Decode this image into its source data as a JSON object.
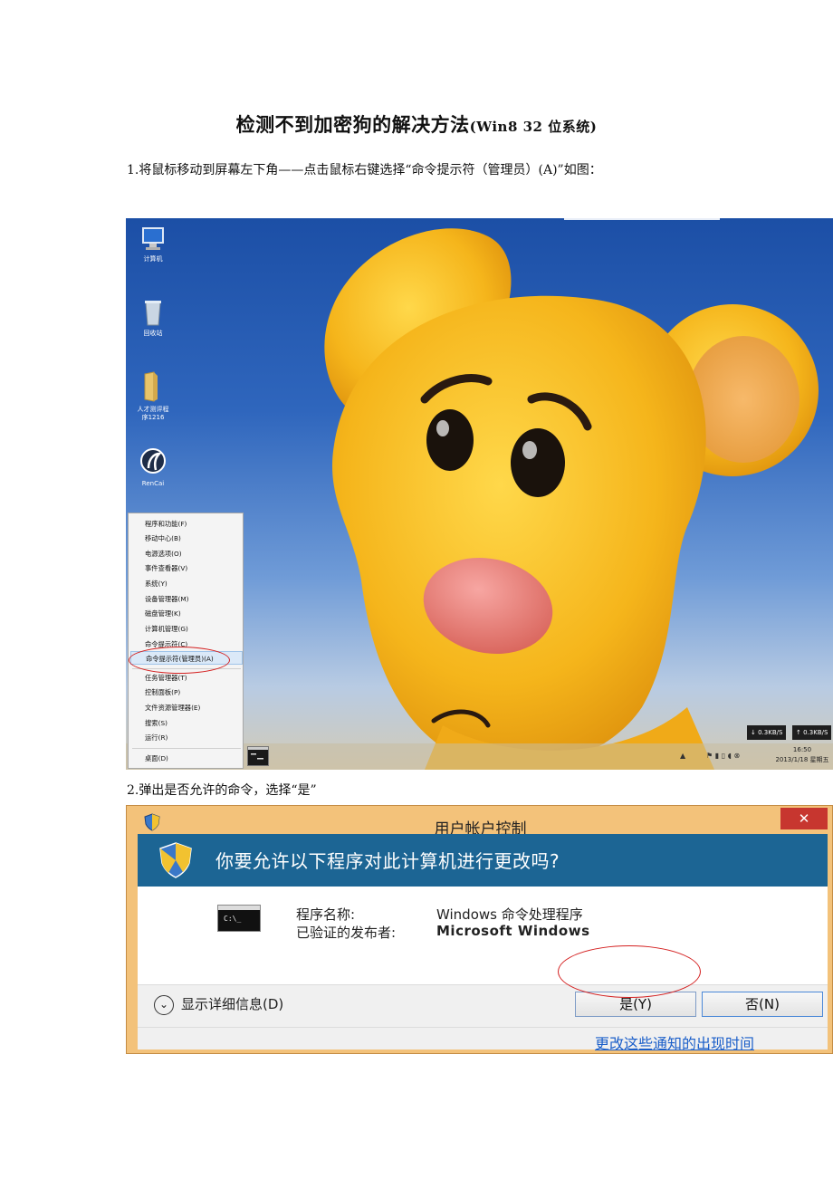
{
  "document": {
    "title": "检测不到加密狗的解决方法",
    "title_suffix": "(Win8 32 位系统)",
    "step1": "1.将鼠标移动到屏幕左下角——点击鼠标右键选择“命令提示符（管理员）(A)”如图：",
    "step2": "2.弹出是否允许的命令，选择“是”"
  },
  "desktop": {
    "icons": [
      {
        "label": "计算机",
        "icon": "computer-icon"
      },
      {
        "label": "回收站",
        "icon": "recycle-bin-icon"
      },
      {
        "label_line1": "人才测评程",
        "label_line2": "序1216",
        "icon": "folder-icon"
      },
      {
        "label": "RenCai",
        "icon": "rencai-app-icon"
      }
    ],
    "context_menu": [
      "程序和功能(F)",
      "移动中心(B)",
      "电源选项(O)",
      "事件查看器(V)",
      "系统(Y)",
      "设备管理器(M)",
      "磁盘管理(K)",
      "计算机管理(G)",
      "命令提示符(C)",
      "命令提示符(管理员)(A)",
      "任务管理器(T)",
      "控制面板(P)",
      "文件资源管理器(E)",
      "搜索(S)",
      "运行(R)",
      "桌面(D)"
    ],
    "net_down": "↓ 0.3KB/S",
    "net_up": "↑ 0.3KB/S",
    "clock_time": "16:50",
    "clock_date": "2013/1/18 星期五"
  },
  "uac": {
    "title": "用户帐户控制",
    "close": "✕",
    "question": "你要允许以下程序对此计算机进行更改吗?",
    "program_name_label": "程序名称:",
    "program_name_value": "Windows 命令处理程序",
    "publisher_label": "已验证的发布者:",
    "publisher_value": "Microsoft Windows",
    "details": "显示详细信息(D)",
    "yes": "是(Y)",
    "no": "否(N)",
    "link": "更改这些通知的出现时间"
  },
  "colors": {
    "uac_banner": "#1c6594",
    "uac_frame": "#f3c27a",
    "highlight_oval": "#d42020"
  }
}
